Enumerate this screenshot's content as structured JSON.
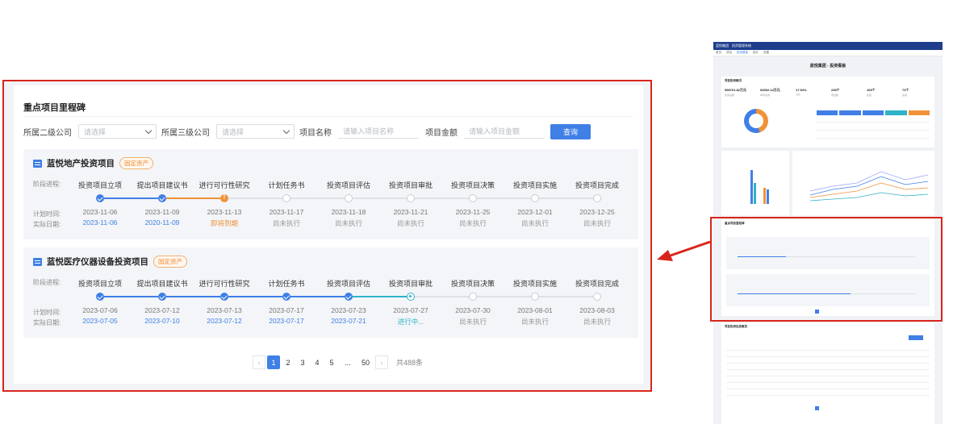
{
  "milestones": {
    "title": "重点项目里程碑",
    "filters": [
      {
        "label": "所属二级公司",
        "placeholder": "请选择",
        "type": "select"
      },
      {
        "label": "所属三级公司",
        "placeholder": "请选择",
        "type": "select"
      },
      {
        "label": "项目名称",
        "placeholder": "请输入项目名称",
        "type": "input"
      },
      {
        "label": "项目金额",
        "placeholder": "请输入项目金额",
        "type": "input"
      }
    ],
    "query_label": "查询",
    "row_labels": {
      "stage": "阶段进程:",
      "plan": "计划时间:",
      "actual": "实际日期:"
    },
    "projects": [
      {
        "name": "蓝悦地产投资项目",
        "tag": "固定资产",
        "stages": [
          {
            "name": "投资项目立项",
            "plan": "2023-11-06",
            "actual": "2023-11-06",
            "status": "done"
          },
          {
            "name": "提出项目建议书",
            "plan": "2023-11-09",
            "actual": "2020-11-09",
            "status": "done"
          },
          {
            "name": "进行可行性研究",
            "plan": "2023-11-13",
            "actual": "即将到期",
            "status": "warn"
          },
          {
            "name": "计划任务书",
            "plan": "2023-11-17",
            "actual": "尚未执行",
            "status": "todo"
          },
          {
            "name": "投资项目评估",
            "plan": "2023-11-18",
            "actual": "尚未执行",
            "status": "todo"
          },
          {
            "name": "投资项目审批",
            "plan": "2023-11-21",
            "actual": "尚未执行",
            "status": "todo"
          },
          {
            "name": "投资项目决策",
            "plan": "2023-11-25",
            "actual": "尚未执行",
            "status": "todo"
          },
          {
            "name": "投资项目实施",
            "plan": "2023-12-01",
            "actual": "尚未执行",
            "status": "todo"
          },
          {
            "name": "投资项目完成",
            "plan": "2023-12-25",
            "actual": "尚未执行",
            "status": "todo"
          }
        ]
      },
      {
        "name": "蓝悦医疗仪器设备投资项目",
        "tag": "固定资产",
        "stages": [
          {
            "name": "投资项目立项",
            "plan": "2023-07-06",
            "actual": "2023-07-05",
            "status": "done"
          },
          {
            "name": "提出项目建议书",
            "plan": "2023-07-12",
            "actual": "2023-07-10",
            "status": "done"
          },
          {
            "name": "进行可行性研究",
            "plan": "2023-07-13",
            "actual": "2023-07-12",
            "status": "done"
          },
          {
            "name": "计划任务书",
            "plan": "2023-07-17",
            "actual": "2023-07-17",
            "status": "done"
          },
          {
            "name": "投资项目评估",
            "plan": "2023-07-23",
            "actual": "2023-07-21",
            "status": "done"
          },
          {
            "name": "投资项目审批",
            "plan": "2023-07-27",
            "actual": "进行中...",
            "status": "active"
          },
          {
            "name": "投资项目决策",
            "plan": "2023-07-30",
            "actual": "尚未执行",
            "status": "todo"
          },
          {
            "name": "投资项目实施",
            "plan": "2023-08-01",
            "actual": "尚未执行",
            "status": "todo"
          },
          {
            "name": "投资项目完成",
            "plan": "2023-08-03",
            "actual": "尚未执行",
            "status": "todo"
          }
        ]
      }
    ],
    "pagination": {
      "prev": "‹",
      "pages": [
        "1",
        "2",
        "3",
        "4",
        "5",
        "...",
        "50"
      ],
      "current": "1",
      "next": "›",
      "total": "共488条"
    }
  },
  "thumbnail": {
    "brand": "蓝悦集团",
    "system": "投资管理系统",
    "nav": [
      "首页",
      "项目",
      "投资看板",
      "统计",
      "设置"
    ],
    "page_title": "蓝悦集团 - 投资看板",
    "overview_title": "项目投资概况",
    "kpis": [
      {
        "value": "558761.82万元",
        "label": "投资总额"
      },
      {
        "value": "94532.14万元",
        "label": "本年投资"
      },
      {
        "value": "17.54%",
        "label": "占比"
      },
      {
        "value": "238个",
        "label": "项目数"
      },
      {
        "value": "165个",
        "label": "在建"
      },
      {
        "value": "73个",
        "label": "完成"
      }
    ],
    "milestone_title": "重点项目里程碑",
    "list_title": "项目投资信息概览"
  }
}
